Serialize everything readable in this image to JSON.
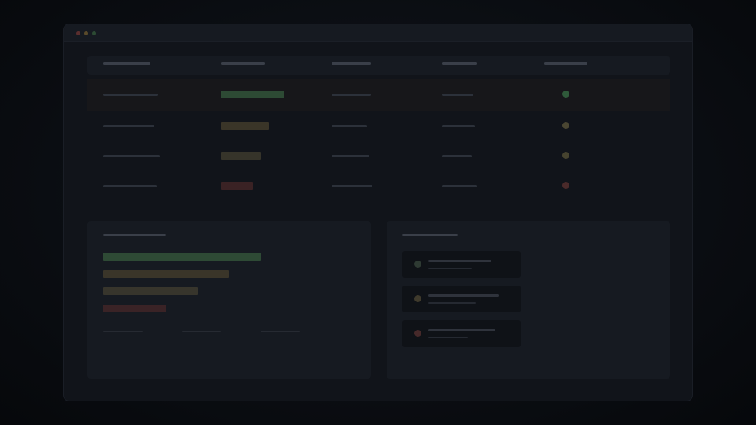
{
  "window": {
    "controls": [
      "close",
      "minimize",
      "maximize"
    ]
  },
  "table": {
    "columns": 5,
    "rows": [
      {
        "status_color": "#2f5a3a",
        "badge_color": "#2d4a34",
        "selected": true
      },
      {
        "status_color": "#4a4632",
        "badge_color": "#3a3528",
        "selected": false
      },
      {
        "status_color": "#46432f",
        "badge_color": "#36342a",
        "selected": false
      },
      {
        "status_color": "#4a2a2a",
        "badge_color": "#3a2224",
        "selected": false
      }
    ]
  },
  "bar_panel": {
    "bars": [
      {
        "color": "#2e4a35",
        "fraction": 1.0
      },
      {
        "color": "#3a3529",
        "fraction": 0.8
      },
      {
        "color": "#37352c",
        "fraction": 0.6
      },
      {
        "color": "#3a2326",
        "fraction": 0.4
      }
    ]
  },
  "status_panel": {
    "cards": [
      {
        "dot_color": "#2e3a33"
      },
      {
        "dot_color": "#3f3a2c"
      },
      {
        "dot_color": "#46292a"
      }
    ]
  },
  "colors": {
    "background": "#07090d",
    "window": "#11141a",
    "panel": "#161a21",
    "success": "#2f5a3a",
    "warning": "#4a4632",
    "danger": "#4a2a2a"
  }
}
